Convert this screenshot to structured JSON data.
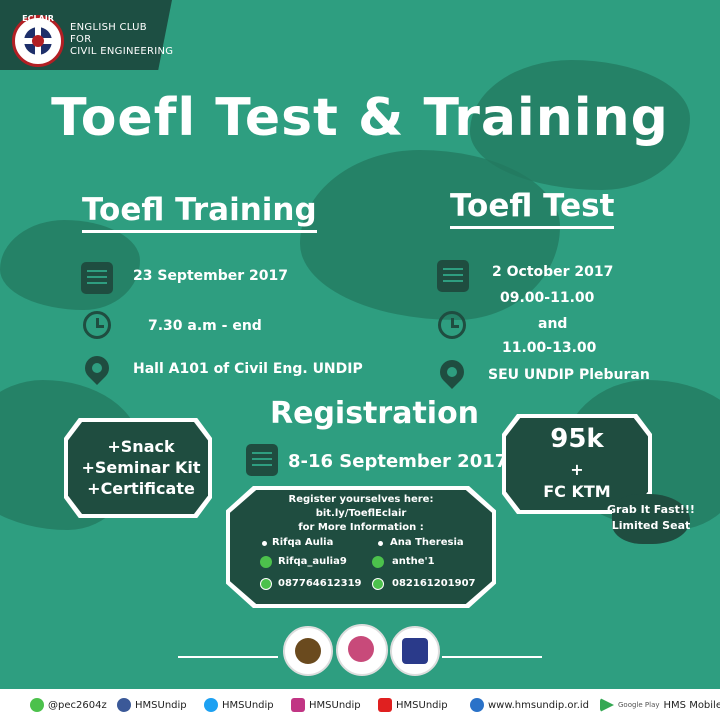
{
  "header": {
    "logo_text": "ECLAIR",
    "club_line1": "ENGLISH CLUB",
    "club_line2": "FOR",
    "club_line3": "CIVIL ENGINEERING"
  },
  "title": "Toefl Test & Training",
  "training": {
    "heading": "Toefl Training",
    "date": "23 September 2017",
    "time": "7.30 a.m - end",
    "place": "Hall A101 of Civil Eng. UNDIP"
  },
  "test": {
    "heading": "Toefl Test",
    "date": "2 October 2017",
    "time1": "09.00-11.00",
    "and": "and",
    "time2": "11.00-13.00",
    "place": "SEU UNDIP Pleburan"
  },
  "benefits": {
    "line1": "+Snack",
    "line2": "+Seminar Kit",
    "line3": "+Certificate"
  },
  "price": {
    "main": "95k",
    "plus": "+",
    "sub": "FC KTM"
  },
  "grab": {
    "line1": "Grab It Fast!!!",
    "line2": "Limited Seat"
  },
  "registration": {
    "title": "Registration",
    "date": "8-16 September 2017"
  },
  "contact": {
    "register_label": "Register yourselves here:",
    "link": "bit.ly/ToeflEclair",
    "more_info": "for More Information :",
    "person1": "Rifqa Aulia",
    "person1_line": "Rifqa_aulia9",
    "person1_wa": "087764612319",
    "person2": "Ana Theresia",
    "person2_line": "anthe'1",
    "person2_wa": "082161201907"
  },
  "footer": {
    "line": "@pec2604z",
    "facebook": "HMSUndip",
    "twitter": "HMSUndip",
    "instagram": "HMSUndip",
    "youtube": "HMSUndip",
    "web": "www.hmsundip.or.id",
    "play_label": "Google Play",
    "play": "HMS Mobile"
  },
  "colors": {
    "background": "#2e9e80",
    "dark_green": "#1f4d40",
    "accent_red": "#b21f24"
  }
}
